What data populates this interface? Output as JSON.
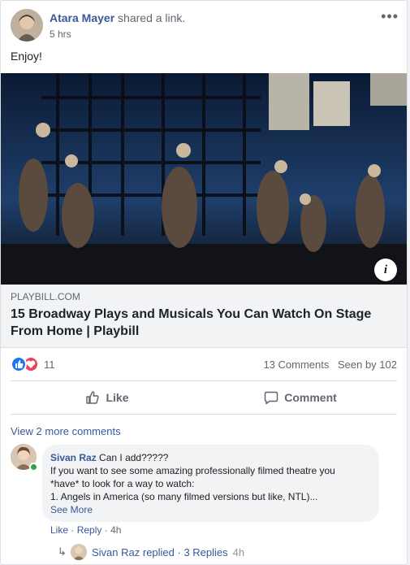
{
  "post": {
    "author": "Atara Mayer",
    "action": "shared a link.",
    "time": "5 hrs",
    "text": "Enjoy!",
    "more_icon": "more-horizontal-icon"
  },
  "link": {
    "domain": "PLAYBILL.COM",
    "title": "15 Broadway Plays and Musicals You Can Watch On Stage From Home | Playbill",
    "info_icon": "i"
  },
  "stats": {
    "reaction_count": "11",
    "comments": "13 Comments",
    "seen_by": "Seen by 102",
    "reactions": [
      "like",
      "love"
    ]
  },
  "actions": {
    "like_label": "Like",
    "comment_label": "Comment"
  },
  "comments_section": {
    "view_more": "View 2 more comments",
    "comment": {
      "author": "Sivan Raz",
      "first_line": "Can I add?????",
      "line2": "If you want to see some amazing professionally filmed theatre you",
      "line3": "*have* to look for a way to watch:",
      "line4": "1. Angels in America (so many filmed versions but like, NTL)...",
      "see_more": "See More",
      "like": "Like",
      "reply": "Reply",
      "time": "4h",
      "separator": "·"
    },
    "replies": {
      "text": "Sivan Raz replied · 3 Replies",
      "time": "4h"
    }
  },
  "colors": {
    "link_blue": "#385898",
    "like_blue": "#1877f2",
    "love_red": "#f33e58",
    "online_green": "#31a24c"
  }
}
